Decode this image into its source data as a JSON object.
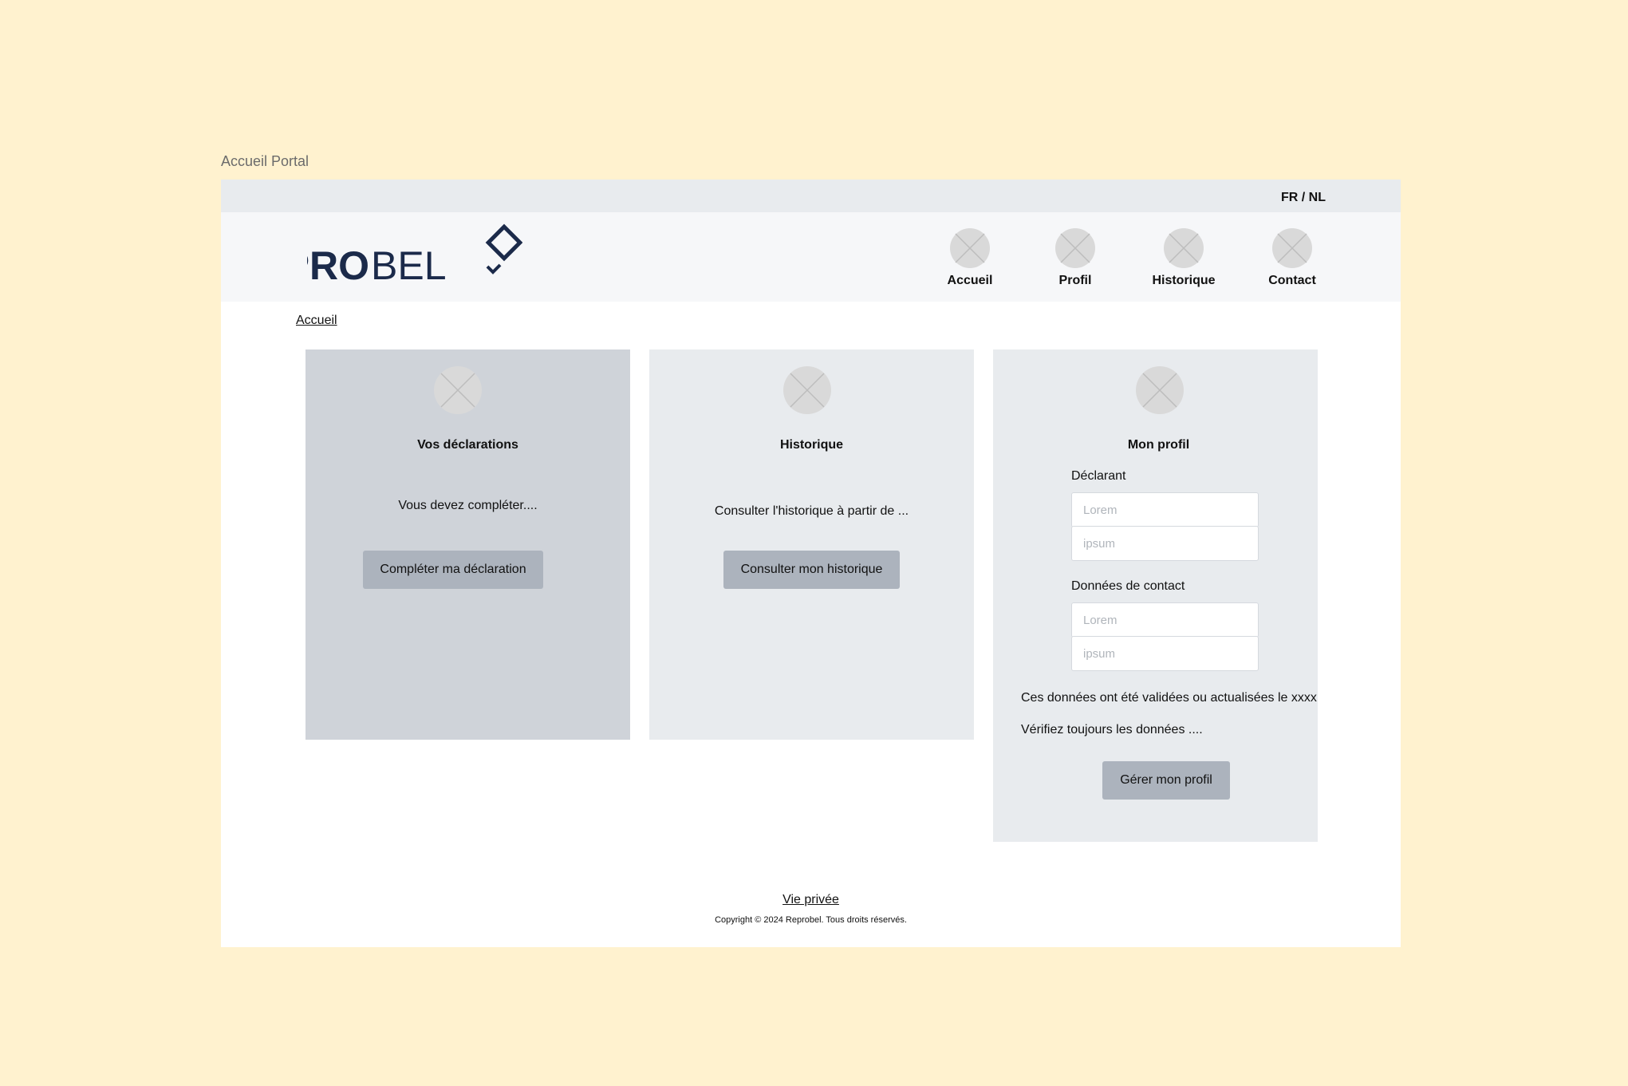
{
  "frame": {
    "title": "Accueil Portal"
  },
  "topbar": {
    "language_switch": "FR / NL"
  },
  "logo": {
    "text_bold": "REPRO",
    "text_light": "BEL"
  },
  "nav": {
    "items": [
      {
        "label": "Accueil",
        "icon": "image-placeholder-icon"
      },
      {
        "label": "Profil",
        "icon": "image-placeholder-icon"
      },
      {
        "label": "Historique",
        "icon": "image-placeholder-icon"
      },
      {
        "label": "Contact",
        "icon": "image-placeholder-icon"
      }
    ]
  },
  "breadcrumb": {
    "current": "Accueil"
  },
  "cards": {
    "declarations": {
      "title": "Vos déclarations",
      "text": "Vous devez compléter....",
      "button": "Compléter ma déclaration"
    },
    "history": {
      "title": "Historique",
      "text": "Consulter l'historique à partir de ...",
      "button": "Consulter mon historique"
    },
    "profile": {
      "title": "Mon profil",
      "declarant_label": "Déclarant",
      "declarant_placeholders": [
        "Lorem",
        "ipsum"
      ],
      "contact_label": "Données de contact",
      "contact_placeholders": [
        "Lorem",
        "ipsum"
      ],
      "validated_note": "Ces données ont été validées ou actualisées le xxxx",
      "verify_note": "Vérifiez toujours les données ....",
      "button": "Gérer mon profil"
    }
  },
  "footer": {
    "privacy_link": "Vie privée",
    "copyright": "Copyright © 2024 Reprobel. Tous droits réservés."
  },
  "colors": {
    "page_background": "#fff2cf",
    "lang_bar": "#e8ebee",
    "header": "#f6f7f9",
    "card_active": "#cfd3d9",
    "card": "#e8ebee",
    "button": "#acb3bd",
    "logo_navy": "#1b2a4a",
    "placeholder_icon": "#d9d9d9"
  }
}
